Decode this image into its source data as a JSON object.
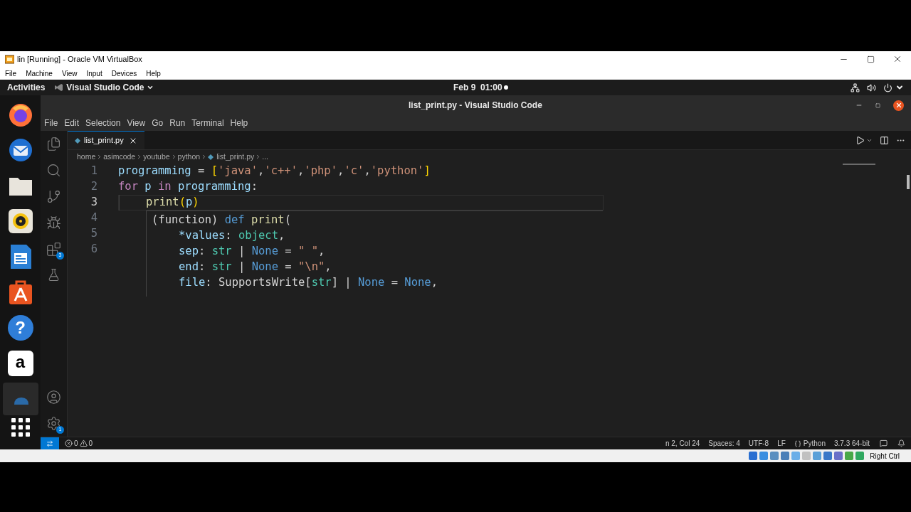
{
  "vbox": {
    "title": "lin [Running] - Oracle VM VirtualBox",
    "menu": [
      "File",
      "Machine",
      "View",
      "Input",
      "Devices",
      "Help"
    ],
    "host_key": "Right Ctrl"
  },
  "top_bar": {
    "activities": "Activities",
    "app": "Visual Studio Code",
    "clock": "Feb 9  01:00"
  },
  "dock": [
    {
      "kind": "firefox",
      "selected": false
    },
    {
      "kind": "mail",
      "selected": false
    },
    {
      "kind": "files",
      "selected": false
    },
    {
      "kind": "music",
      "selected": false
    },
    {
      "kind": "writer",
      "selected": false
    },
    {
      "kind": "software",
      "selected": false
    },
    {
      "kind": "help",
      "label": "?",
      "selected": false
    },
    {
      "kind": "store",
      "label": "a",
      "selected": false
    },
    {
      "kind": "code",
      "selected": true
    }
  ],
  "vscode": {
    "title": "list_print.py - Visual Studio Code",
    "menu": [
      "File",
      "Edit",
      "Selection",
      "View",
      "Go",
      "Run",
      "Terminal",
      "Help"
    ],
    "activity_badges": {
      "extensions": "3",
      "settings": "1"
    },
    "tabs": [
      {
        "label": "list_print.py",
        "selected": true
      }
    ],
    "breadcrumb": [
      "home",
      "asimcode",
      "youtube",
      "python",
      "list_print.py",
      "..."
    ],
    "lines": [
      {
        "number": "1",
        "current": false,
        "tokens": [
          {
            "text": "programming",
            "kind": "var"
          },
          {
            "text": " = ",
            "kind": "op"
          },
          {
            "text": "[",
            "kind": "bracket"
          },
          {
            "text": "'java'",
            "kind": "string"
          },
          {
            "text": ",",
            "kind": "op"
          },
          {
            "text": "'c++'",
            "kind": "string"
          },
          {
            "text": ",",
            "kind": "op"
          },
          {
            "text": "'php'",
            "kind": "string"
          },
          {
            "text": ",",
            "kind": "op"
          },
          {
            "text": "'c'",
            "kind": "string"
          },
          {
            "text": ",",
            "kind": "op"
          },
          {
            "text": "'python'",
            "kind": "string"
          },
          {
            "text": "]",
            "kind": "bracket"
          }
        ]
      },
      {
        "number": "2",
        "current": false,
        "tokens": [
          {
            "text": "for",
            "kind": "keyword"
          },
          {
            "text": " p ",
            "kind": "var"
          },
          {
            "text": "in",
            "kind": "keyword"
          },
          {
            "text": " programming",
            "kind": "var"
          },
          {
            "text": ":",
            "kind": "op"
          }
        ],
        "children": [
          {
            "number": "3",
            "current": true,
            "tokens": [
              {
                "text": "print",
                "kind": "func"
              },
              {
                "text": "(",
                "kind": "bracket"
              },
              {
                "text": "p",
                "kind": "var"
              },
              {
                "text": ")",
                "kind": "bracket"
              }
            ]
          }
        ]
      },
      {
        "number": "4",
        "current": false
      },
      {
        "number": "5",
        "current": false
      },
      {
        "number": "6",
        "current": false
      }
    ],
    "hover": {
      "tokens": [
        {
          "text": "(function) ",
          "kind": "op"
        },
        {
          "text": "def",
          "kind": "def"
        },
        {
          "text": " print",
          "kind": "func"
        },
        {
          "text": "(",
          "kind": "op"
        }
      ],
      "children": [
        {
          "tokens": [
            {
              "text": "*values",
              "kind": "var"
            },
            {
              "text": ": ",
              "kind": "op"
            },
            {
              "text": "object",
              "kind": "type"
            },
            {
              "text": ",",
              "kind": "op"
            }
          ]
        },
        {
          "tokens": [
            {
              "text": "sep",
              "kind": "var"
            },
            {
              "text": ": ",
              "kind": "op"
            },
            {
              "text": "str",
              "kind": "type"
            },
            {
              "text": " | ",
              "kind": "op"
            },
            {
              "text": "None",
              "kind": "def"
            },
            {
              "text": " = ",
              "kind": "op"
            },
            {
              "text": "\" \"",
              "kind": "string"
            },
            {
              "text": ",",
              "kind": "op"
            }
          ]
        },
        {
          "tokens": [
            {
              "text": "end",
              "kind": "var"
            },
            {
              "text": ": ",
              "kind": "op"
            },
            {
              "text": "str",
              "kind": "type"
            },
            {
              "text": " | ",
              "kind": "op"
            },
            {
              "text": "None",
              "kind": "def"
            },
            {
              "text": " = ",
              "kind": "op"
            },
            {
              "text": "\"\\n\"",
              "kind": "string"
            },
            {
              "text": ",",
              "kind": "op"
            }
          ]
        },
        {
          "tokens": [
            {
              "text": "file",
              "kind": "var"
            },
            {
              "text": ": SupportsWrite[",
              "kind": "op"
            },
            {
              "text": "str",
              "kind": "type"
            },
            {
              "text": "] | ",
              "kind": "op"
            },
            {
              "text": "None",
              "kind": "def"
            },
            {
              "text": " = ",
              "kind": "op"
            },
            {
              "text": "None",
              "kind": "def"
            },
            {
              "text": ",",
              "kind": "op"
            }
          ]
        }
      ]
    },
    "status": {
      "errors": "0",
      "warnings": "0",
      "position": "n 2, Col 24",
      "spaces": "Spaces: 4",
      "encoding": "UTF-8",
      "eol": "LF",
      "language": "Python",
      "interpreter": "3.7.3 64-bit"
    }
  }
}
